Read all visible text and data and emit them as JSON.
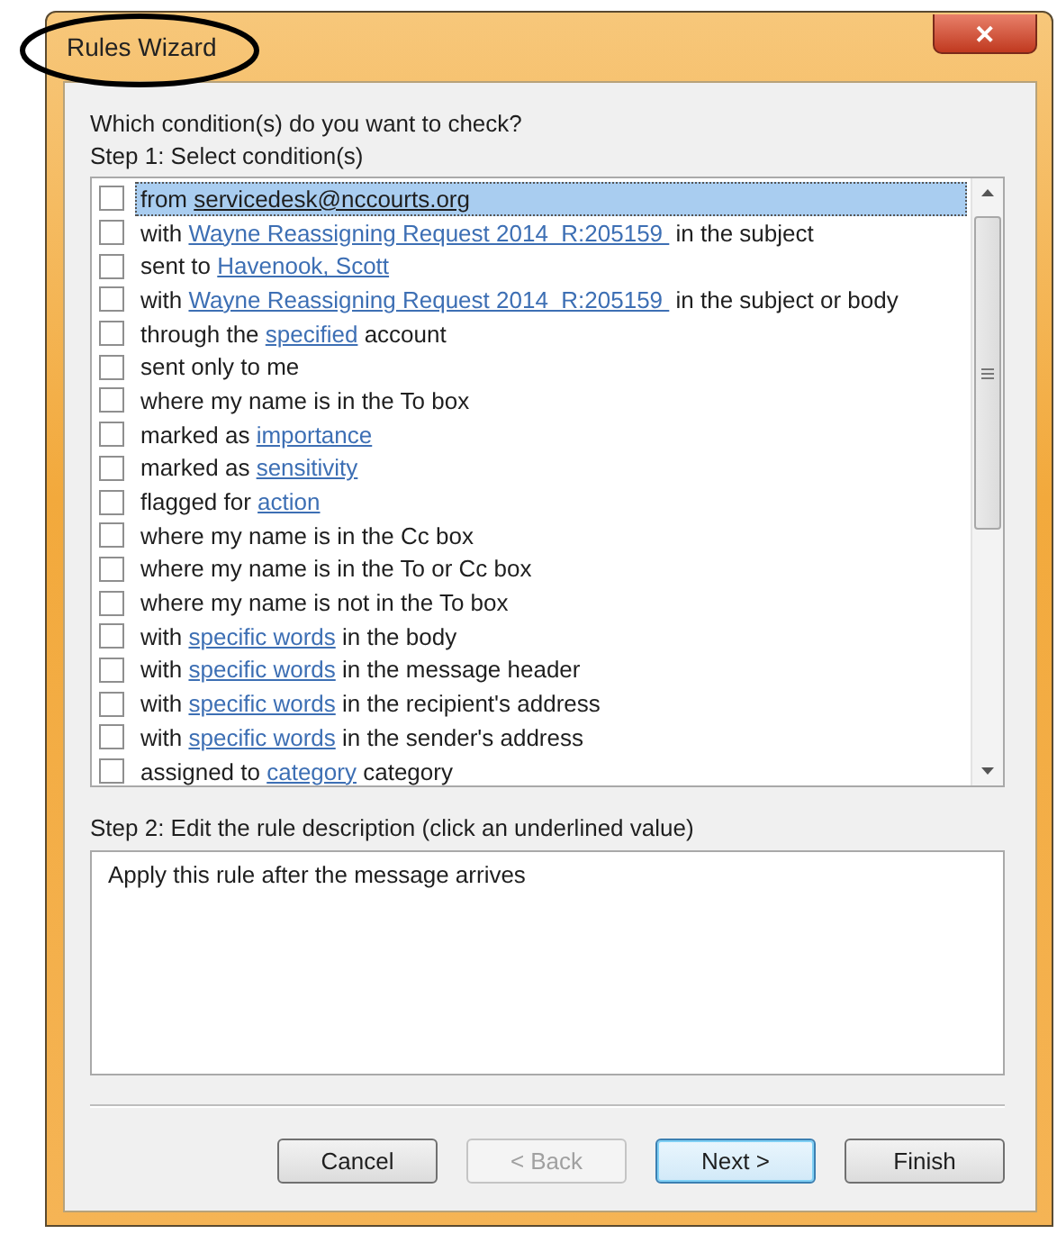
{
  "window": {
    "title": "Rules Wizard",
    "close": "✕"
  },
  "prompt": "Which condition(s) do you want to check?",
  "step1_label": "Step 1: Select condition(s)",
  "conditions": [
    {
      "checked": false,
      "selected": true,
      "segments": [
        {
          "kind": "text",
          "text": "from "
        },
        {
          "kind": "link",
          "text": "servicedesk@nccourts.org"
        }
      ]
    },
    {
      "checked": false,
      "selected": false,
      "segments": [
        {
          "kind": "text",
          "text": "with "
        },
        {
          "kind": "link",
          "text": "Wayne Reassigning Request 2014  R:205159 "
        },
        {
          "kind": "text",
          "text": " in the subject"
        }
      ]
    },
    {
      "checked": false,
      "selected": false,
      "segments": [
        {
          "kind": "text",
          "text": "sent to "
        },
        {
          "kind": "link",
          "text": "Havenook, Scott"
        }
      ]
    },
    {
      "checked": false,
      "selected": false,
      "segments": [
        {
          "kind": "text",
          "text": "with "
        },
        {
          "kind": "link",
          "text": "Wayne Reassigning Request 2014  R:205159 "
        },
        {
          "kind": "text",
          "text": " in the subject or body"
        }
      ]
    },
    {
      "checked": false,
      "selected": false,
      "segments": [
        {
          "kind": "text",
          "text": "through the "
        },
        {
          "kind": "link",
          "text": "specified"
        },
        {
          "kind": "text",
          "text": " account"
        }
      ]
    },
    {
      "checked": false,
      "selected": false,
      "segments": [
        {
          "kind": "text",
          "text": "sent only to me"
        }
      ]
    },
    {
      "checked": false,
      "selected": false,
      "segments": [
        {
          "kind": "text",
          "text": "where my name is in the To box"
        }
      ]
    },
    {
      "checked": false,
      "selected": false,
      "segments": [
        {
          "kind": "text",
          "text": "marked as "
        },
        {
          "kind": "link",
          "text": "importance"
        }
      ]
    },
    {
      "checked": false,
      "selected": false,
      "segments": [
        {
          "kind": "text",
          "text": "marked as "
        },
        {
          "kind": "link",
          "text": "sensitivity"
        }
      ]
    },
    {
      "checked": false,
      "selected": false,
      "segments": [
        {
          "kind": "text",
          "text": "flagged for "
        },
        {
          "kind": "link",
          "text": "action"
        }
      ]
    },
    {
      "checked": false,
      "selected": false,
      "segments": [
        {
          "kind": "text",
          "text": "where my name is in the Cc box"
        }
      ]
    },
    {
      "checked": false,
      "selected": false,
      "segments": [
        {
          "kind": "text",
          "text": "where my name is in the To or Cc box"
        }
      ]
    },
    {
      "checked": false,
      "selected": false,
      "segments": [
        {
          "kind": "text",
          "text": "where my name is not in the To box"
        }
      ]
    },
    {
      "checked": false,
      "selected": false,
      "segments": [
        {
          "kind": "text",
          "text": "with "
        },
        {
          "kind": "link",
          "text": "specific words"
        },
        {
          "kind": "text",
          "text": " in the body"
        }
      ]
    },
    {
      "checked": false,
      "selected": false,
      "segments": [
        {
          "kind": "text",
          "text": "with "
        },
        {
          "kind": "link",
          "text": "specific words"
        },
        {
          "kind": "text",
          "text": " in the message header"
        }
      ]
    },
    {
      "checked": false,
      "selected": false,
      "segments": [
        {
          "kind": "text",
          "text": "with "
        },
        {
          "kind": "link",
          "text": "specific words"
        },
        {
          "kind": "text",
          "text": " in the recipient's address"
        }
      ]
    },
    {
      "checked": false,
      "selected": false,
      "segments": [
        {
          "kind": "text",
          "text": "with "
        },
        {
          "kind": "link",
          "text": "specific words"
        },
        {
          "kind": "text",
          "text": " in the sender's address"
        }
      ]
    },
    {
      "checked": false,
      "selected": false,
      "segments": [
        {
          "kind": "text",
          "text": "assigned to "
        },
        {
          "kind": "link",
          "text": "category"
        },
        {
          "kind": "text",
          "text": " category"
        }
      ]
    }
  ],
  "step2_label": "Step 2: Edit the rule description (click an underlined value)",
  "description": "Apply this rule after the message arrives",
  "buttons": [
    {
      "label": "Cancel",
      "disabled": false,
      "default": false
    },
    {
      "label": "< Back",
      "disabled": true,
      "default": false
    },
    {
      "label": "Next >",
      "disabled": false,
      "default": true
    },
    {
      "label": "Finish",
      "disabled": false,
      "default": false
    }
  ]
}
